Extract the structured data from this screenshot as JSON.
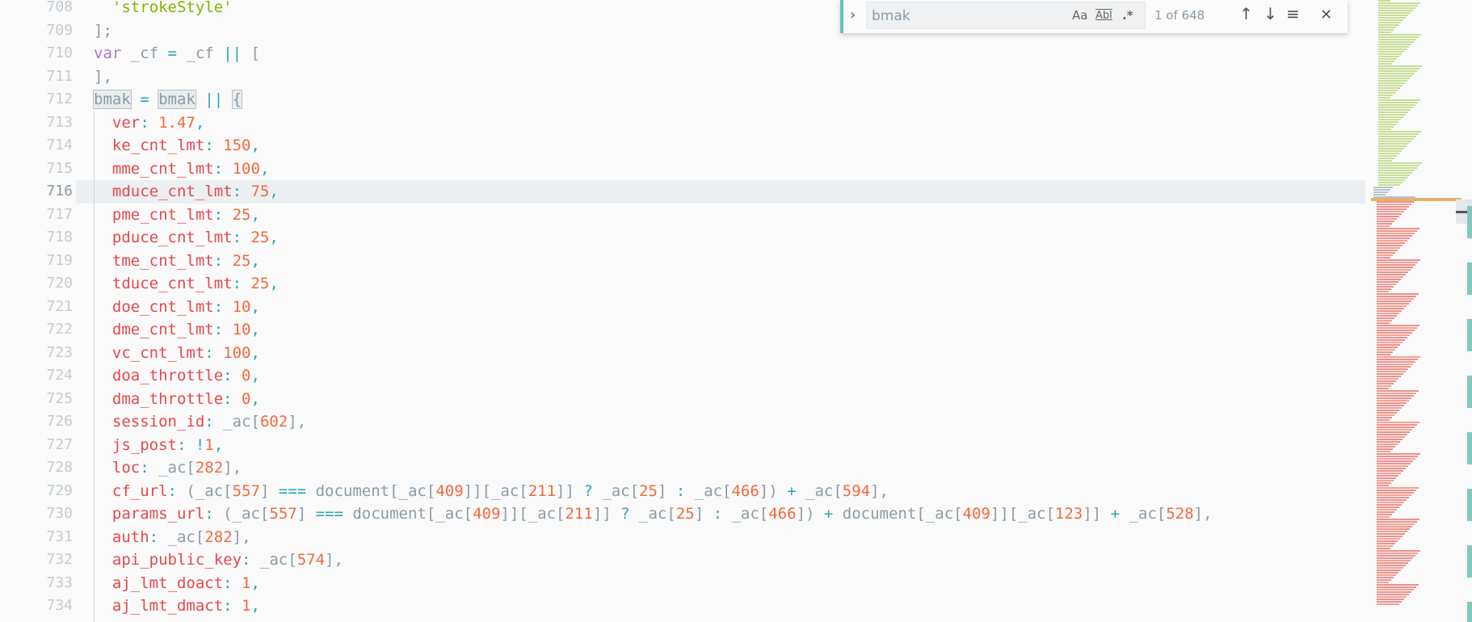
{
  "editor": {
    "first_line": 708,
    "current_line": 716,
    "lines": [
      [
        [
          "  ",
          "t"
        ],
        [
          "'strokeStyle'",
          "s"
        ]
      ],
      [
        [
          "];",
          "t"
        ]
      ],
      [
        [
          "var",
          "v"
        ],
        [
          " _cf ",
          "t"
        ],
        [
          "=",
          "p"
        ],
        [
          " _cf ",
          "t"
        ],
        [
          "||",
          "p"
        ],
        [
          " [",
          "t"
        ]
      ],
      [
        [
          "],",
          "t"
        ]
      ],
      [
        [
          "bmak",
          "m"
        ],
        [
          " = ",
          "p"
        ],
        [
          "bmak",
          "m"
        ],
        [
          " || ",
          "p"
        ],
        [
          "{",
          "m"
        ]
      ],
      [
        [
          "  ver",
          "k"
        ],
        [
          ": ",
          "p"
        ],
        [
          "1.47",
          "n"
        ],
        [
          ",",
          "p"
        ]
      ],
      [
        [
          "  ke_cnt_lmt",
          "k"
        ],
        [
          ": ",
          "p"
        ],
        [
          "150",
          "n"
        ],
        [
          ",",
          "p"
        ]
      ],
      [
        [
          "  mme_cnt_lmt",
          "k"
        ],
        [
          ": ",
          "p"
        ],
        [
          "100",
          "n"
        ],
        [
          ",",
          "p"
        ]
      ],
      [
        [
          "  mduce_cnt_lmt",
          "k"
        ],
        [
          ": ",
          "p"
        ],
        [
          "75",
          "n"
        ],
        [
          ",",
          "p"
        ]
      ],
      [
        [
          "  pme_cnt_lmt",
          "k"
        ],
        [
          ": ",
          "p"
        ],
        [
          "25",
          "n"
        ],
        [
          ",",
          "p"
        ]
      ],
      [
        [
          "  pduce_cnt_lmt",
          "k"
        ],
        [
          ": ",
          "p"
        ],
        [
          "25",
          "n"
        ],
        [
          ",",
          "p"
        ]
      ],
      [
        [
          "  tme_cnt_lmt",
          "k"
        ],
        [
          ": ",
          "p"
        ],
        [
          "25",
          "n"
        ],
        [
          ",",
          "p"
        ]
      ],
      [
        [
          "  tduce_cnt_lmt",
          "k"
        ],
        [
          ": ",
          "p"
        ],
        [
          "25",
          "n"
        ],
        [
          ",",
          "p"
        ]
      ],
      [
        [
          "  doe_cnt_lmt",
          "k"
        ],
        [
          ": ",
          "p"
        ],
        [
          "10",
          "n"
        ],
        [
          ",",
          "p"
        ]
      ],
      [
        [
          "  dme_cnt_lmt",
          "k"
        ],
        [
          ": ",
          "p"
        ],
        [
          "10",
          "n"
        ],
        [
          ",",
          "p"
        ]
      ],
      [
        [
          "  vc_cnt_lmt",
          "k"
        ],
        [
          ": ",
          "p"
        ],
        [
          "100",
          "n"
        ],
        [
          ",",
          "p"
        ]
      ],
      [
        [
          "  doa_throttle",
          "k"
        ],
        [
          ": ",
          "p"
        ],
        [
          "0",
          "n"
        ],
        [
          ",",
          "p"
        ]
      ],
      [
        [
          "  dma_throttle",
          "k"
        ],
        [
          ": ",
          "p"
        ],
        [
          "0",
          "n"
        ],
        [
          ",",
          "p"
        ]
      ],
      [
        [
          "  session_id",
          "k"
        ],
        [
          ": ",
          "p"
        ],
        [
          "_ac[",
          "t"
        ],
        [
          "602",
          "n"
        ],
        [
          "],",
          "t"
        ]
      ],
      [
        [
          "  js_post",
          "k"
        ],
        [
          ": ",
          "p"
        ],
        [
          "!",
          "p"
        ],
        [
          "1",
          "n"
        ],
        [
          ",",
          "p"
        ]
      ],
      [
        [
          "  loc",
          "k"
        ],
        [
          ": ",
          "p"
        ],
        [
          "_ac[",
          "t"
        ],
        [
          "282",
          "n"
        ],
        [
          "],",
          "t"
        ]
      ],
      [
        [
          "  cf_url",
          "k"
        ],
        [
          ": ",
          "p"
        ],
        [
          "(_ac[",
          "t"
        ],
        [
          "557",
          "n"
        ],
        [
          "] ",
          "t"
        ],
        [
          "===",
          "p"
        ],
        [
          " document[_ac[",
          "t"
        ],
        [
          "409",
          "n"
        ],
        [
          "]][_ac[",
          "t"
        ],
        [
          "211",
          "n"
        ],
        [
          "]] ",
          "t"
        ],
        [
          "?",
          "p"
        ],
        [
          " _ac[",
          "t"
        ],
        [
          "25",
          "n"
        ],
        [
          "] ",
          "t"
        ],
        [
          ":",
          "p"
        ],
        [
          " _ac[",
          "t"
        ],
        [
          "466",
          "n"
        ],
        [
          "]) ",
          "t"
        ],
        [
          "+",
          "p"
        ],
        [
          " _ac[",
          "t"
        ],
        [
          "594",
          "n"
        ],
        [
          "],",
          "t"
        ]
      ],
      [
        [
          "  params_url",
          "k"
        ],
        [
          ": ",
          "p"
        ],
        [
          "(_ac[",
          "t"
        ],
        [
          "557",
          "n"
        ],
        [
          "] ",
          "t"
        ],
        [
          "===",
          "p"
        ],
        [
          " document[_ac[",
          "t"
        ],
        [
          "409",
          "n"
        ],
        [
          "]][_ac[",
          "t"
        ],
        [
          "211",
          "n"
        ],
        [
          "]] ",
          "t"
        ],
        [
          "?",
          "p"
        ],
        [
          " _ac[",
          "t"
        ],
        [
          "25",
          "n"
        ],
        [
          "] ",
          "t"
        ],
        [
          ":",
          "p"
        ],
        [
          " _ac[",
          "t"
        ],
        [
          "466",
          "n"
        ],
        [
          "]) ",
          "t"
        ],
        [
          "+",
          "p"
        ],
        [
          " document[_ac[",
          "t"
        ],
        [
          "409",
          "n"
        ],
        [
          "]][_ac[",
          "t"
        ],
        [
          "123",
          "n"
        ],
        [
          "]] ",
          "t"
        ],
        [
          "+",
          "p"
        ],
        [
          " _ac[",
          "t"
        ],
        [
          "528",
          "n"
        ],
        [
          "],",
          "t"
        ]
      ],
      [
        [
          "  auth",
          "k"
        ],
        [
          ": ",
          "p"
        ],
        [
          "_ac[",
          "t"
        ],
        [
          "282",
          "n"
        ],
        [
          "],",
          "t"
        ]
      ],
      [
        [
          "  api_public_key",
          "k"
        ],
        [
          ": ",
          "p"
        ],
        [
          "_ac[",
          "t"
        ],
        [
          "574",
          "n"
        ],
        [
          "],",
          "t"
        ]
      ],
      [
        [
          "  aj_lmt_doact",
          "k"
        ],
        [
          ": ",
          "p"
        ],
        [
          "1",
          "n"
        ],
        [
          ",",
          "p"
        ]
      ],
      [
        [
          "  aj_lmt_dmact",
          "k"
        ],
        [
          ": ",
          "p"
        ],
        [
          "1",
          "n"
        ],
        [
          ",",
          "p"
        ]
      ]
    ]
  },
  "find": {
    "value": "bmak",
    "match_case": "Aa",
    "whole_word": "Abl",
    "regex": ".*",
    "count": "1 of 648",
    "expand_icon": "chevron-right-icon",
    "prev_icon": "arrow-up-icon",
    "next_icon": "arrow-down-icon",
    "selection_icon": "lines-icon",
    "close_icon": "close-icon"
  },
  "colors": {
    "key": "#e5484d",
    "number": "#f4683c",
    "punct": "#2aa5b5",
    "text": "#8b9ba6",
    "string": "#86b300",
    "accent": "#66c5b8"
  }
}
